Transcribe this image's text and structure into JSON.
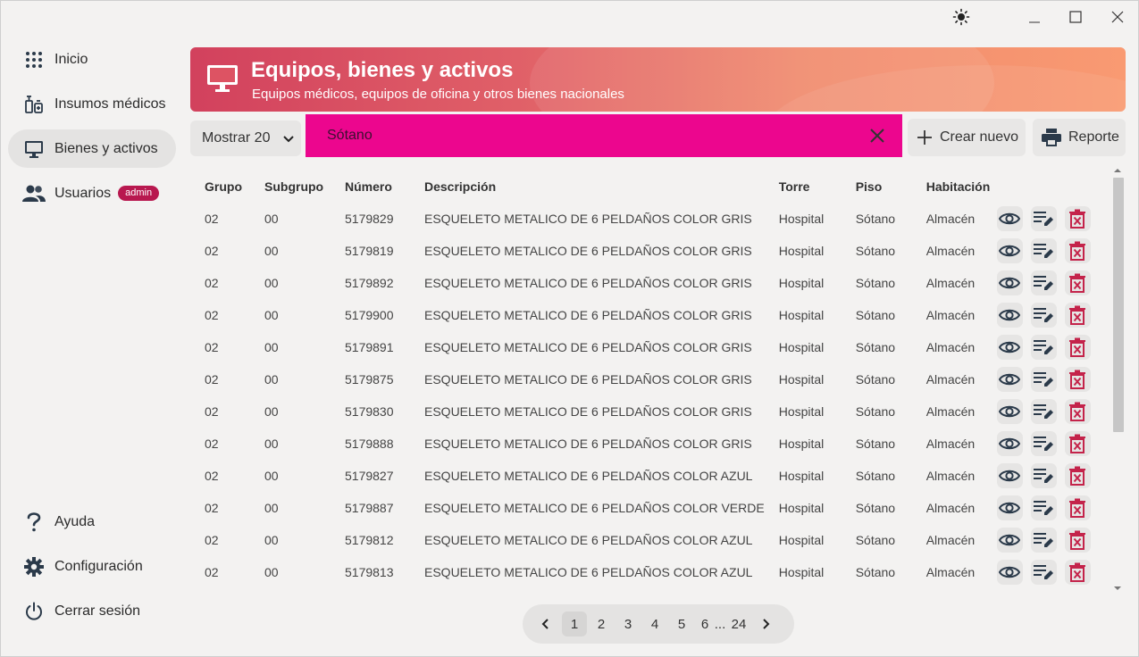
{
  "window": {
    "theme_icon": "sun-icon",
    "minimize_icon": "minimize-icon",
    "maximize_icon": "maximize-icon",
    "close_icon": "close-icon"
  },
  "sidebar": {
    "items": [
      {
        "label": "Inicio",
        "icon": "grid-dots-icon"
      },
      {
        "label": "Insumos médicos",
        "icon": "medical-supplies-icon"
      },
      {
        "label": "Bienes y activos",
        "icon": "monitor-icon",
        "active": true
      },
      {
        "label": "Usuarios",
        "icon": "users-icon",
        "badge": "admin"
      }
    ],
    "bottom": [
      {
        "label": "Ayuda",
        "icon": "question-icon"
      },
      {
        "label": "Configuración",
        "icon": "gear-icon"
      },
      {
        "label": "Cerrar sesión",
        "icon": "power-icon"
      }
    ]
  },
  "header": {
    "title": "Equipos, bienes y activos",
    "subtitle": "Equipos médicos, equipos de oficina y otros bienes nacionales",
    "icon": "monitor-icon"
  },
  "toolbar": {
    "show_select": "Mostrar 20",
    "search_value": "Sótano",
    "create_label": "Crear nuevo",
    "report_label": "Reporte"
  },
  "table": {
    "columns": [
      "Grupo",
      "Subgrupo",
      "Número",
      "Descripción",
      "Torre",
      "Piso",
      "Habitación"
    ],
    "rows": [
      [
        "02",
        "00",
        "5179829",
        "ESQUELETO METALICO DE 6 PELDAÑOS COLOR GRIS",
        "Hospital",
        "Sótano",
        "Almacén"
      ],
      [
        "02",
        "00",
        "5179819",
        "ESQUELETO METALICO DE 6 PELDAÑOS COLOR GRIS",
        "Hospital",
        "Sótano",
        "Almacén"
      ],
      [
        "02",
        "00",
        "5179892",
        "ESQUELETO METALICO DE 6 PELDAÑOS COLOR GRIS",
        "Hospital",
        "Sótano",
        "Almacén"
      ],
      [
        "02",
        "00",
        "5179900",
        "ESQUELETO METALICO DE 6 PELDAÑOS COLOR GRIS",
        "Hospital",
        "Sótano",
        "Almacén"
      ],
      [
        "02",
        "00",
        "5179891",
        "ESQUELETO METALICO DE 6 PELDAÑOS COLOR GRIS",
        "Hospital",
        "Sótano",
        "Almacén"
      ],
      [
        "02",
        "00",
        "5179875",
        "ESQUELETO METALICO DE 6 PELDAÑOS COLOR GRIS",
        "Hospital",
        "Sótano",
        "Almacén"
      ],
      [
        "02",
        "00",
        "5179830",
        "ESQUELETO METALICO DE 6 PELDAÑOS COLOR GRIS",
        "Hospital",
        "Sótano",
        "Almacén"
      ],
      [
        "02",
        "00",
        "5179888",
        "ESQUELETO METALICO DE 6 PELDAÑOS COLOR GRIS",
        "Hospital",
        "Sótano",
        "Almacén"
      ],
      [
        "02",
        "00",
        "5179827",
        "ESQUELETO METALICO DE 6 PELDAÑOS COLOR AZUL",
        "Hospital",
        "Sótano",
        "Almacén"
      ],
      [
        "02",
        "00",
        "5179887",
        "ESQUELETO METALICO DE 6 PELDAÑOS COLOR VERDE",
        "Hospital",
        "Sótano",
        "Almacén"
      ],
      [
        "02",
        "00",
        "5179812",
        "ESQUELETO METALICO DE 6 PELDAÑOS COLOR AZUL",
        "Hospital",
        "Sótano",
        "Almacén"
      ],
      [
        "02",
        "00",
        "5179813",
        "ESQUELETO METALICO DE 6 PELDAÑOS COLOR AZUL",
        "Hospital",
        "Sótano",
        "Almacén"
      ]
    ],
    "row_actions": [
      "eye-icon",
      "edit-icon",
      "delete-icon"
    ]
  },
  "pagination": {
    "pages": [
      "1",
      "2",
      "3",
      "4",
      "5",
      "6"
    ],
    "ellipsis": "...",
    "last": "24",
    "current": "1"
  },
  "colors": {
    "accent_magenta": "#ec068e",
    "banner_start": "#d2415d",
    "banner_end": "#f99a72",
    "delete_red": "#c4234a",
    "badge": "#b8184f"
  }
}
